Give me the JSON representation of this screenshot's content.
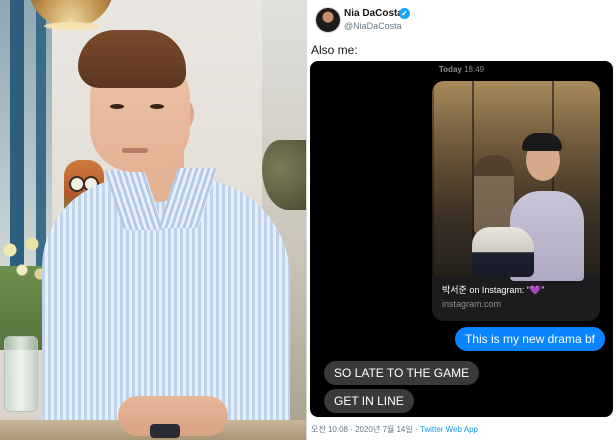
{
  "tweet": {
    "author_name": "Nia DaCosta",
    "author_handle": "@NiaDaCosta",
    "text": "Also me:",
    "footer_time": "오전 10:08 · 2020년 7월 14일 ·",
    "footer_source": "Twitter Web App",
    "verified_icon": "verified-check-icon",
    "accent_color": "#1da1f2"
  },
  "imessage": {
    "timestamp_day": "Today",
    "timestamp_time": "18:49",
    "link_card": {
      "title": "박서준 on Instagram: “",
      "title_suffix": "”",
      "heart_icon": "purple-heart-icon",
      "heart_glyph": "💜",
      "domain": "instagram.com"
    },
    "messages": [
      {
        "sender": "me",
        "text": "This is my new drama bf",
        "color": "#0a84ff"
      },
      {
        "sender": "other",
        "text": "SO LATE TO THE GAME",
        "color": "#3a3a3c"
      },
      {
        "sender": "other",
        "text": "GET IN LINE",
        "color": "#3a3a3c"
      }
    ]
  }
}
